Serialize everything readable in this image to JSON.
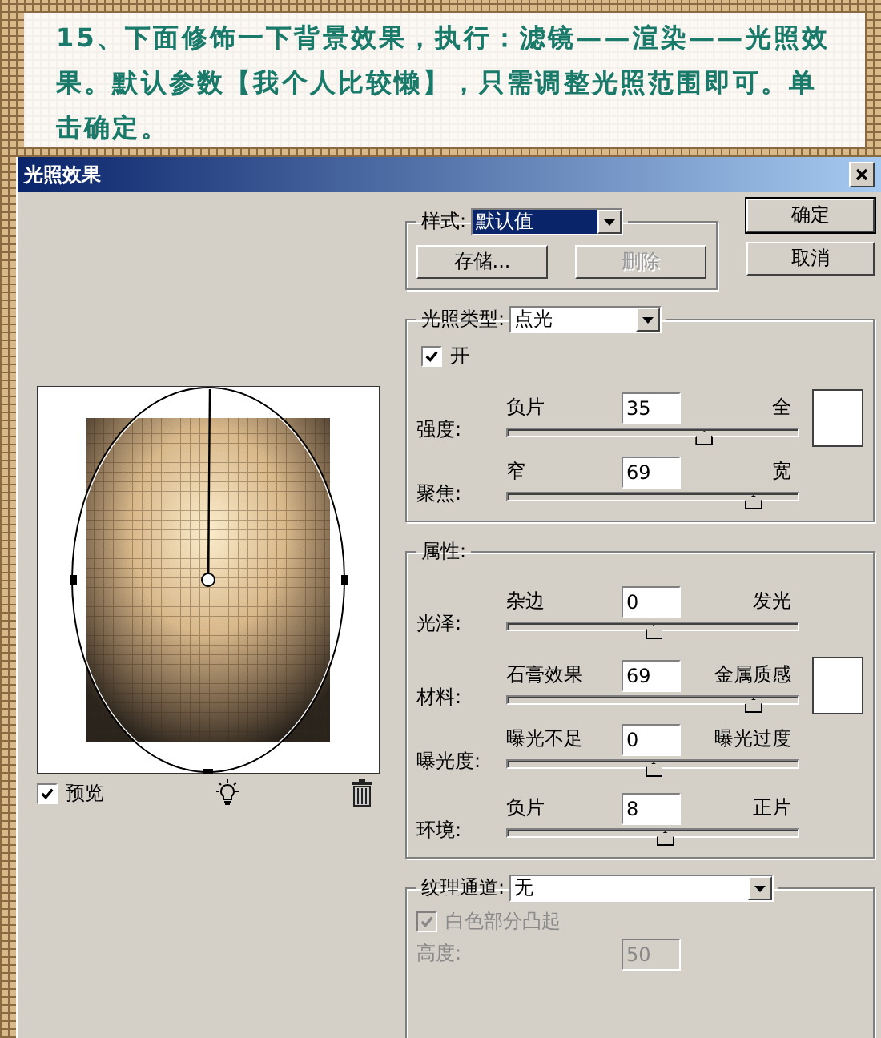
{
  "instruction": "15、下面修饰一下背景效果，执行：滤镜——渲染——光照效果。默认参数【我个人比较懒】，只需调整光照范围即可。单击确定。",
  "dialog": {
    "title": "光照效果",
    "style": {
      "label": "样式:",
      "value": "默认值"
    },
    "style_buttons": [
      {
        "label": "存储...",
        "disabled": false
      },
      {
        "label": "删除",
        "disabled": true
      }
    ],
    "actions": [
      "确定",
      "取消"
    ],
    "light_type": {
      "label": "光照类型:",
      "value": "点光"
    },
    "on": {
      "label": "开",
      "checked": true
    },
    "light_sliders": [
      {
        "label": "强度:",
        "left": "负片",
        "right": "全",
        "value": "35",
        "level": 0.675,
        "swatch": true
      },
      {
        "label": "聚焦:",
        "left": "窄",
        "right": "宽",
        "value": "69",
        "level": 0.845,
        "swatch": false
      }
    ],
    "properties": {
      "title": "属性:",
      "sliders": [
        {
          "label": "光泽:",
          "left": "杂边",
          "right": "发光",
          "value": "0",
          "level": 0.5,
          "swatch": false
        },
        {
          "label": "材料:",
          "left": "石膏效果",
          "right": "金属质感",
          "value": "69",
          "level": 0.845,
          "swatch": true
        },
        {
          "label": "曝光度:",
          "left": "曝光不足",
          "right": "曝光过度",
          "value": "0",
          "level": 0.5,
          "swatch": false
        },
        {
          "label": "环境:",
          "left": "负片",
          "right": "正片",
          "value": "8",
          "level": 0.54,
          "swatch": false
        }
      ]
    },
    "texture": {
      "label": "纹理通道:",
      "value": "无",
      "raise_white": {
        "label": "白色部分凸起",
        "checked": true,
        "disabled": true
      },
      "height": {
        "label": "高度:",
        "value": "50",
        "disabled": true
      }
    },
    "preview": {
      "label": "预览",
      "checked": true
    }
  }
}
